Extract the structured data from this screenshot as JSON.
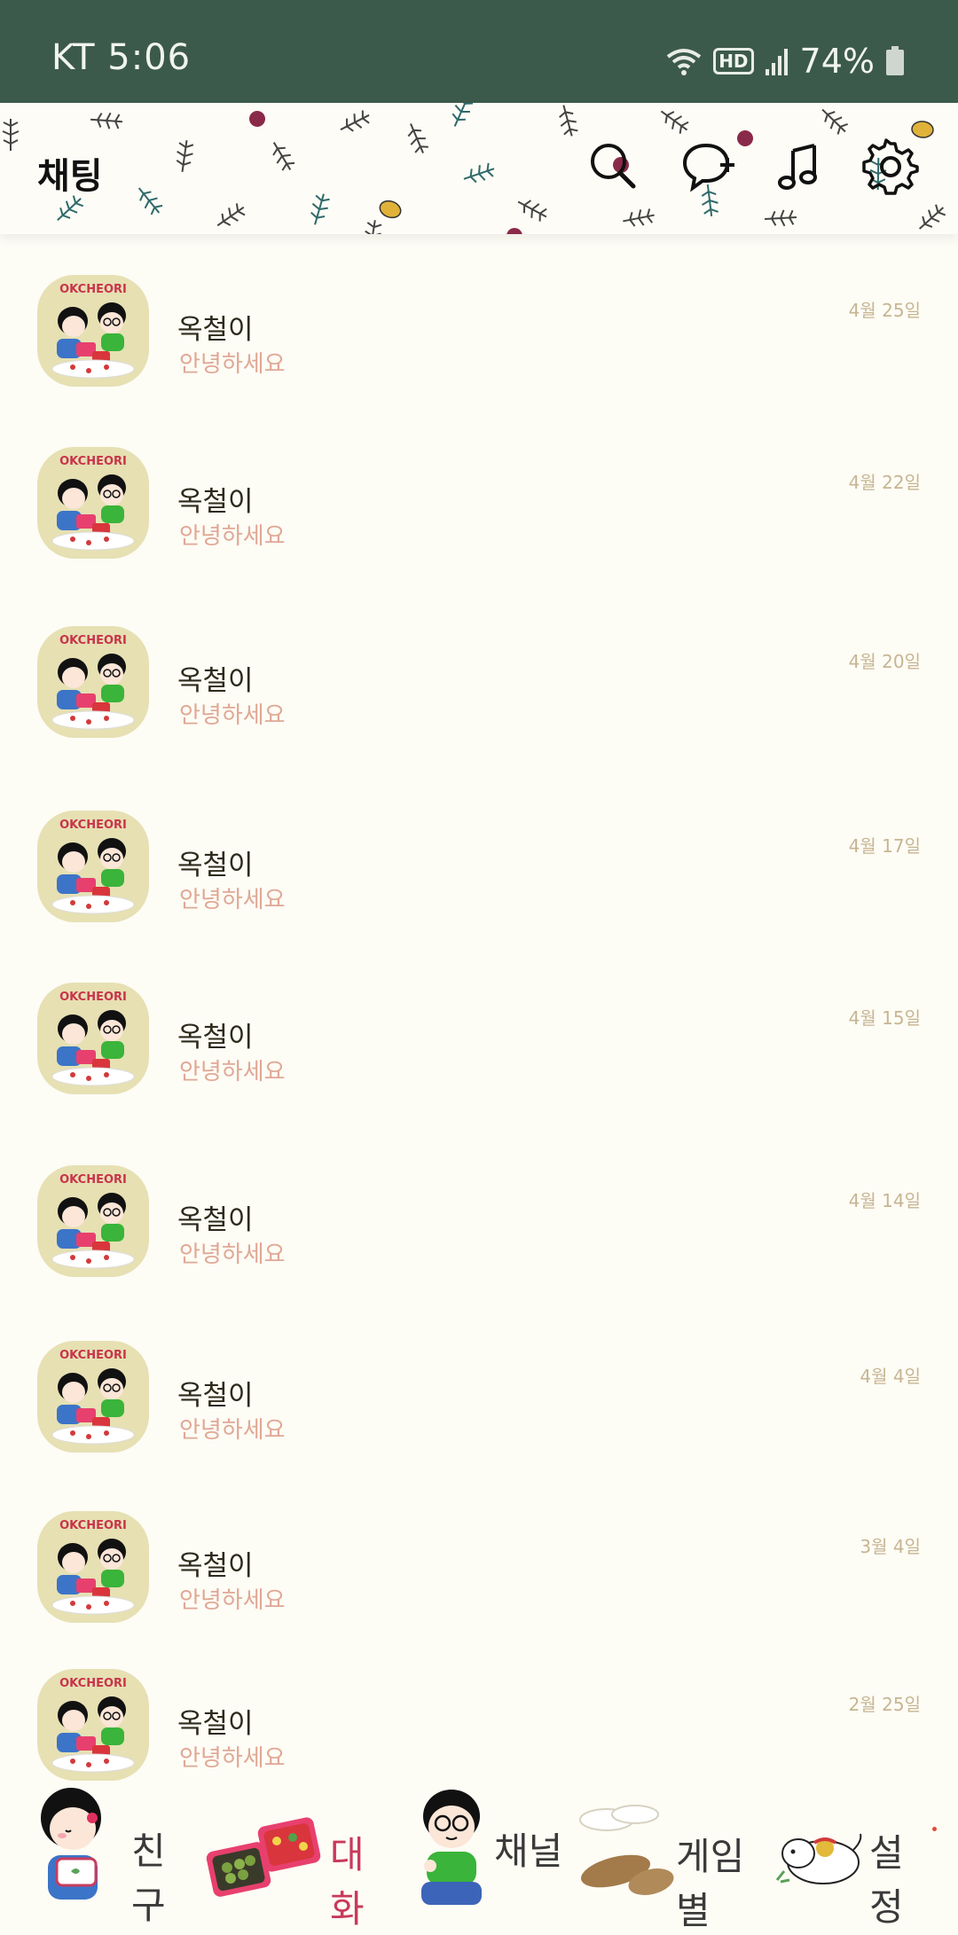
{
  "status_bar": {
    "carrier_time": "KT 5:06",
    "network_label": "HD",
    "battery": "74%"
  },
  "header": {
    "title": "채팅",
    "icons": [
      "search-icon",
      "new-chat-icon",
      "music-icon",
      "settings-icon"
    ]
  },
  "chats": [
    {
      "name": "옥철이",
      "message": "안녕하세요",
      "date": "4월 25일",
      "avatar_text": "OKCHEORI"
    },
    {
      "name": "옥철이",
      "message": "안녕하세요",
      "date": "4월 22일",
      "avatar_text": "OKCHEORI"
    },
    {
      "name": "옥철이",
      "message": "안녕하세요",
      "date": "4월 20일",
      "avatar_text": "OKCHEORI"
    },
    {
      "name": "옥철이",
      "message": "안녕하세요",
      "date": "4월 17일",
      "avatar_text": "OKCHEORI"
    },
    {
      "name": "옥철이",
      "message": "안녕하세요",
      "date": "4월 15일",
      "avatar_text": "OKCHEORI"
    },
    {
      "name": "옥철이",
      "message": "안녕하세요",
      "date": "4월 14일",
      "avatar_text": "OKCHEORI"
    },
    {
      "name": "옥철이",
      "message": "안녕하세요",
      "date": "4월 4일",
      "avatar_text": "OKCHEORI"
    },
    {
      "name": "옥철이",
      "message": "안녕하세요",
      "date": "3월 4일",
      "avatar_text": "OKCHEORI"
    },
    {
      "name": "옥철이",
      "message": "안녕하세요",
      "date": "2월 25일",
      "avatar_text": "OKCHEORI"
    }
  ],
  "bottom_nav": {
    "friends": "친구",
    "chats": "대화",
    "channel": "채널",
    "games": "게임별",
    "settings": "설정"
  },
  "colors": {
    "status_bar": "#3c5a4b",
    "background": "#fdfcf5",
    "message": "#e0a895",
    "date": "#c7b592"
  }
}
